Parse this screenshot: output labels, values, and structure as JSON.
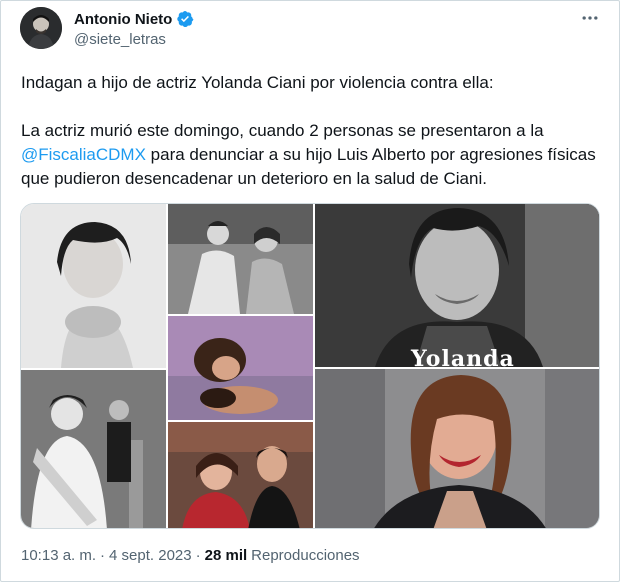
{
  "author": {
    "name": "Antonio Nieto",
    "handle": "@siete_letras",
    "verified_color": "#1d9bf0"
  },
  "tweet": {
    "line1": "Indagan a hijo de actriz Yolanda Ciani por violencia contra ella:",
    "line2_before": "La actriz murió este domingo, cuando 2 personas se presentaron a la ",
    "mention": "@FiscaliaCDMX",
    "line2_after": " para denunciar a su hijo Luis Alberto por agresiones físicas que pudieron desencadenar un deterioro en la salud de Ciani."
  },
  "media": {
    "overlay_text": "Yolanda"
  },
  "meta": {
    "time": "10:13 a. m.",
    "dot": "·",
    "date": "4 sept. 2023",
    "views_count": "28 mil",
    "views_label": "Reproducciones"
  },
  "icons": {
    "more": "more-horizontal-icon",
    "verified": "verified-badge-icon"
  }
}
